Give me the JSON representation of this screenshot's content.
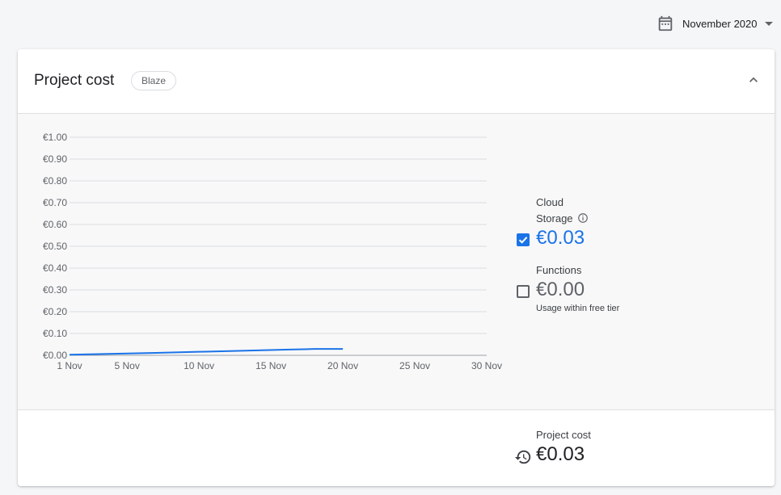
{
  "month_picker": {
    "label": "November 2020",
    "icon": "calendar-icon"
  },
  "card": {
    "title": "Project cost",
    "plan_badge": "Blaze",
    "collapse_icon": "chevron-up-icon"
  },
  "chart_data": {
    "type": "line",
    "y_ticks": [
      "€1.00",
      "€0.90",
      "€0.80",
      "€0.70",
      "€0.60",
      "€0.50",
      "€0.40",
      "€0.30",
      "€0.20",
      "€0.10",
      "€0.00"
    ],
    "x_ticks": [
      "1 Nov",
      "5 Nov",
      "10 Nov",
      "15 Nov",
      "20 Nov",
      "25 Nov",
      "30 Nov"
    ],
    "x_tick_days": [
      1,
      5,
      10,
      15,
      20,
      25,
      30
    ],
    "xlim": [
      1,
      30
    ],
    "ylim": [
      0,
      1
    ],
    "grid": true,
    "series": [
      {
        "color": "#1a73e8",
        "days": [
          1,
          4,
          7,
          10,
          13,
          16,
          18,
          20
        ],
        "values": [
          0.003,
          0.007,
          0.011,
          0.016,
          0.021,
          0.026,
          0.029,
          0.029
        ]
      }
    ]
  },
  "legend": {
    "cloud_storage": {
      "name_line1": "Cloud",
      "name_line2": "Storage",
      "value": "€0.03",
      "checked": true,
      "color": "#1a73e8"
    },
    "functions": {
      "name": "Functions",
      "value": "€0.00",
      "note": "Usage within free tier",
      "checked": false,
      "color": "#5f6368"
    }
  },
  "footer": {
    "label": "Project cost",
    "value": "€0.03",
    "icon": "history-icon"
  }
}
